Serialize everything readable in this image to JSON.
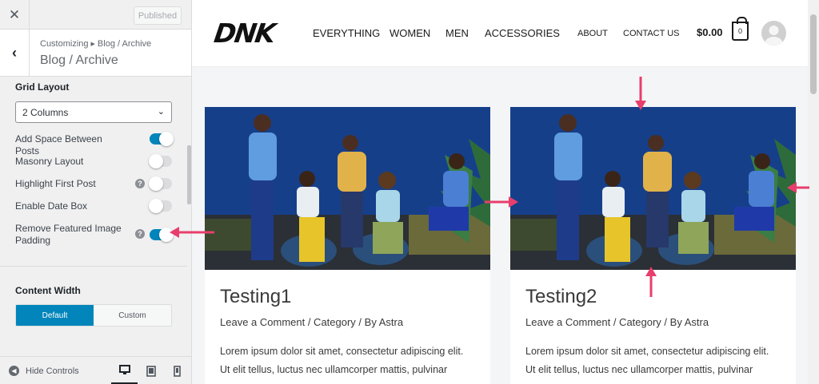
{
  "customizer": {
    "publish_label": "Published",
    "breadcrumb_root": "Customizing",
    "breadcrumb_current": "Blog / Archive",
    "panel_title": "Blog / Archive",
    "grid_layout_label": "Grid Layout",
    "grid_layout_value": "2 Columns",
    "options": [
      {
        "label": "Add Space Between Posts",
        "enabled": true
      },
      {
        "label": "Masonry Layout",
        "enabled": false
      },
      {
        "label": "Highlight First Post",
        "enabled": false
      },
      {
        "label": "Enable Date Box",
        "enabled": false
      },
      {
        "label": "Remove Featured Image Padding",
        "enabled": true
      }
    ],
    "content_width_label": "Content Width",
    "content_width_options": [
      "Default",
      "Custom"
    ],
    "content_width_selected": "Default",
    "hide_controls_label": "Hide Controls"
  },
  "site": {
    "logo": "DNK",
    "nav_main": [
      "EVERYTHING",
      "WOMEN",
      "MEN",
      "ACCESSORIES"
    ],
    "nav_secondary": [
      "ABOUT",
      "CONTACT US"
    ],
    "cart_total": "$0.00",
    "cart_count": "0"
  },
  "posts": [
    {
      "title": "Testing1",
      "meta": "Leave a Comment / Category / By Astra",
      "excerpt": "Lorem ipsum dolor sit amet, consectetur adipiscing elit. Ut elit tellus, luctus nec ullamcorper mattis, pulvinar"
    },
    {
      "title": "Testing2",
      "meta": "Leave a Comment / Category / By Astra",
      "excerpt": "Lorem ipsum dolor sit amet, consectetur adipiscing elit. Ut elit tellus, luctus nec ullamcorper mattis, pulvinar"
    }
  ],
  "colors": {
    "accent": "#0185ba",
    "annotation_arrow": "#e83e6c"
  }
}
